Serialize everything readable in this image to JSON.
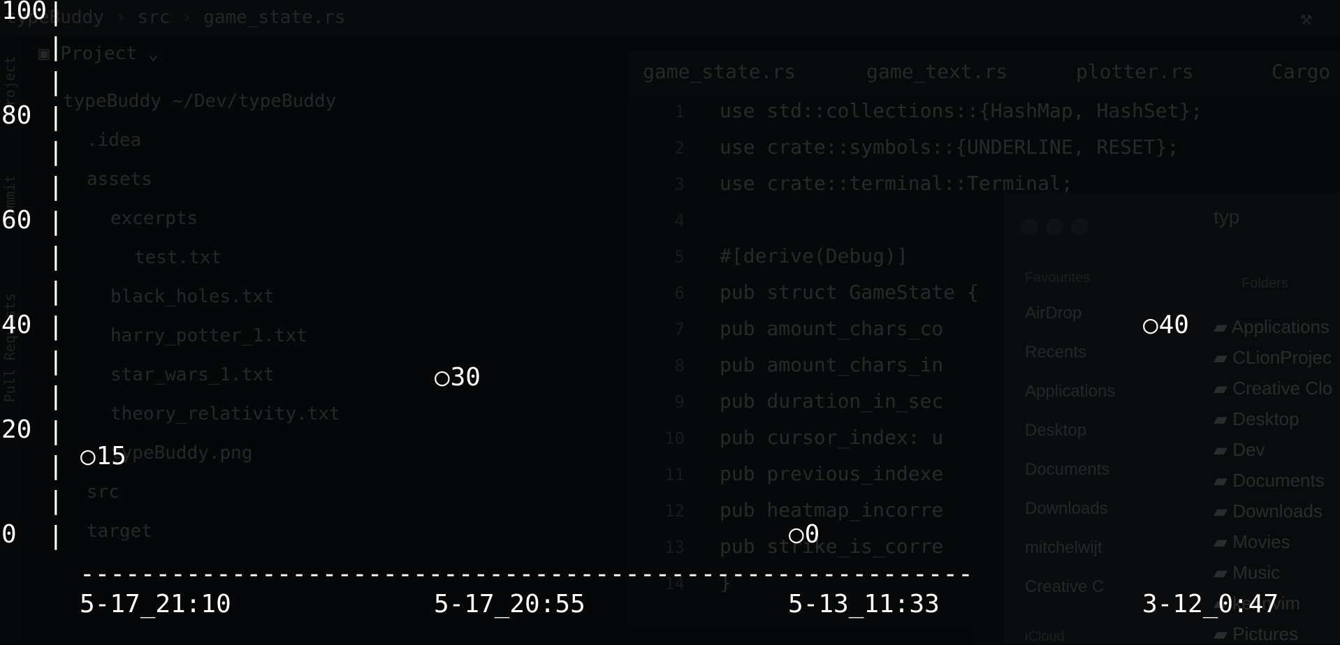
{
  "ide": {
    "breadcrumb": [
      "typeBuddy",
      "src",
      "game_state.rs"
    ],
    "project_panel_title": "Project",
    "tree": [
      {
        "label": "typeBuddy  ~/Dev/typeBuddy",
        "indent": 0
      },
      {
        "label": ".idea",
        "indent": 1
      },
      {
        "label": "assets",
        "indent": 1
      },
      {
        "label": "excerpts",
        "indent": 2
      },
      {
        "label": "test.txt",
        "indent": 3
      },
      {
        "label": "black_holes.txt",
        "indent": 2
      },
      {
        "label": "harry_potter_1.txt",
        "indent": 2
      },
      {
        "label": "star_wars_1.txt",
        "indent": 2
      },
      {
        "label": "theory_relativity.txt",
        "indent": 2
      },
      {
        "label": "typeBuddy.png",
        "indent": 2
      },
      {
        "label": "src",
        "indent": 1
      },
      {
        "label": "target",
        "indent": 1
      }
    ],
    "side_tabs": [
      "Project",
      "Commit",
      "Pull Requests"
    ],
    "editor_tabs": [
      "game_state.rs",
      "game_text.rs",
      "plotter.rs",
      "Cargo"
    ],
    "code_lines": [
      "use std::collections::{HashMap, HashSet};",
      "use crate::symbols::{UNDERLINE, RESET};",
      "use crate::terminal::Terminal;",
      "",
      "#[derive(Debug)]",
      "pub struct GameState {",
      "    pub amount_chars_co",
      "    pub amount_chars_in",
      "    pub duration_in_sec",
      "    pub cursor_index: u",
      "    pub previous_indexe",
      "    pub heatmap_incorre",
      "    pub strike_is_corre",
      "}"
    ],
    "line_numbers": [
      "1",
      "2",
      "3",
      "4",
      "5",
      "6",
      "7",
      "8",
      "9",
      "10",
      "11",
      "12",
      "13",
      "14"
    ]
  },
  "finder": {
    "sidebar_heading": "Favourites",
    "sidebar_items": [
      "AirDrop",
      "Recents",
      "Applications",
      "Desktop",
      "Documents",
      "Downloads",
      "mitchelwijt",
      "Creative C"
    ],
    "icloud_heading": "iCloud",
    "folders_heading": "Folders",
    "folders": [
      "Applications",
      "CLionProjec",
      "Creative Clo",
      "Desktop",
      "Dev",
      "Documents",
      "Downloads",
      "Movies",
      "Music",
      "ker.nvim",
      "Pictures"
    ],
    "nav_text": "typ"
  },
  "chart_data": {
    "type": "scatter",
    "title": "",
    "xlabel": "",
    "ylabel": "",
    "ylim": [
      0,
      100
    ],
    "yticks": [
      "0",
      "20",
      "40",
      "60",
      "80",
      "100"
    ],
    "categories": [
      "5-17_21:10",
      "5-17_20:55",
      "5-13_11:33",
      "3-12_0:47"
    ],
    "values": [
      15,
      30,
      0,
      40
    ],
    "point_labels": [
      "15",
      "30",
      "0",
      "40"
    ],
    "marker": "○",
    "axis_line_char": "|",
    "x_axis_char": "-"
  }
}
